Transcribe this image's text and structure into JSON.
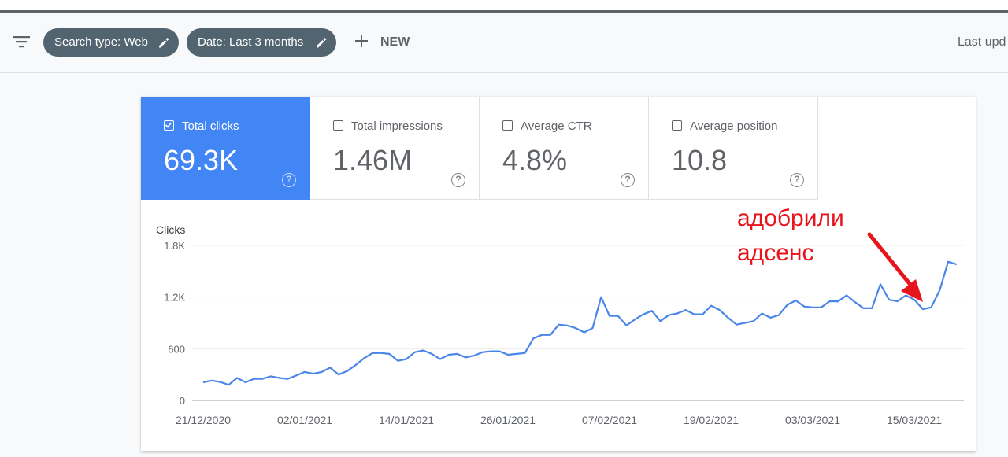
{
  "toolbar": {
    "filter_icon": "filter-list-icon",
    "chips": [
      {
        "label": "Search type: Web",
        "icon": "pencil-icon"
      },
      {
        "label": "Date: Last 3 months",
        "icon": "pencil-icon"
      }
    ],
    "new_label": "NEW",
    "new_icon": "plus-icon",
    "last_updated": "Last upd"
  },
  "metrics": [
    {
      "label": "Total clicks",
      "value": "69.3K",
      "checked": true
    },
    {
      "label": "Total impressions",
      "value": "1.46M",
      "checked": false
    },
    {
      "label": "Average CTR",
      "value": "4.8%",
      "checked": false
    },
    {
      "label": "Average position",
      "value": "10.8",
      "checked": false
    }
  ],
  "help_glyph": "?",
  "colors": {
    "accent": "#4285f4",
    "chip_bg": "#526470",
    "line": "#4a86e8",
    "annotation": "#e8141b"
  },
  "annotation": {
    "line1": "адобрили",
    "line2": "адсенс"
  },
  "chart_data": {
    "type": "line",
    "ylabel": "Clicks",
    "yticks": [
      "1.8K",
      "1.2K",
      "600",
      "0"
    ],
    "ylim": [
      0,
      1800
    ],
    "x_tick_labels": [
      "21/12/2020",
      "02/01/2021",
      "14/01/2021",
      "26/01/2021",
      "07/02/2021",
      "19/02/2021",
      "03/03/2021",
      "15/03/2021"
    ],
    "x_start": "21/12/2020",
    "grid": true,
    "series": [
      {
        "values": [
          210,
          230,
          215,
          180,
          260,
          210,
          250,
          250,
          280,
          260,
          250,
          290,
          330,
          310,
          330,
          380,
          300,
          340,
          410,
          490,
          550,
          550,
          540,
          460,
          480,
          560,
          580,
          540,
          480,
          530,
          540,
          500,
          520,
          560,
          570,
          570,
          530,
          540,
          550,
          720,
          760,
          760,
          880,
          870,
          840,
          790,
          840,
          1200,
          980,
          980,
          870,
          940,
          1000,
          1040,
          920,
          990,
          1010,
          1050,
          1000,
          1000,
          1100,
          1050,
          960,
          880,
          900,
          920,
          1010,
          960,
          990,
          1110,
          1160,
          1090,
          1080,
          1080,
          1150,
          1150,
          1220,
          1140,
          1070,
          1070,
          1350,
          1170,
          1150,
          1220,
          1170,
          1060,
          1080,
          1280,
          1610,
          1580
        ]
      }
    ]
  }
}
